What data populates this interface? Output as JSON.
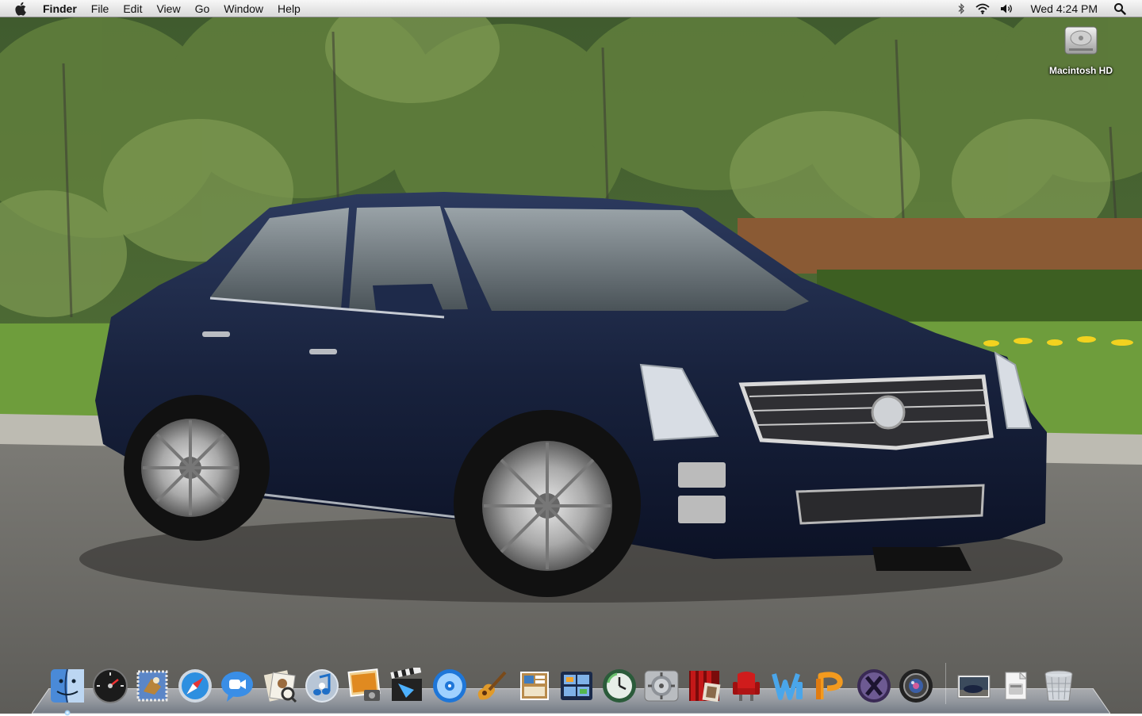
{
  "menubar": {
    "apple_icon": "apple-icon",
    "app_name": "Finder",
    "menus": [
      "File",
      "Edit",
      "View",
      "Go",
      "Window",
      "Help"
    ],
    "status_icons": [
      "bluetooth-icon",
      "wifi-icon",
      "volume-icon"
    ],
    "clock": "Wed 4:24 PM",
    "spotlight_icon": "spotlight-search-icon"
  },
  "desktop": {
    "icons": [
      {
        "label": "Macintosh HD",
        "icon": "hard-drive-icon"
      }
    ]
  },
  "dock": {
    "apps": [
      {
        "icon": "finder-icon",
        "running": true
      },
      {
        "icon": "dashboard-icon",
        "running": false
      },
      {
        "icon": "mail-icon",
        "running": false
      },
      {
        "icon": "safari-icon",
        "running": false
      },
      {
        "icon": "ichat-icon",
        "running": false
      },
      {
        "icon": "address-book-icon",
        "running": false
      },
      {
        "icon": "itunes-icon",
        "running": false
      },
      {
        "icon": "iphoto-icon",
        "running": false
      },
      {
        "icon": "imovie-icon",
        "running": false
      },
      {
        "icon": "idvd-icon",
        "running": false
      },
      {
        "icon": "garageband-icon",
        "running": false
      },
      {
        "icon": "iweb-icon",
        "running": false
      },
      {
        "icon": "spaces-icon",
        "running": false
      },
      {
        "icon": "time-machine-icon",
        "running": false
      },
      {
        "icon": "system-preferences-icon",
        "running": false
      },
      {
        "icon": "front-row-icon",
        "running": false
      },
      {
        "icon": "front-row-chair-icon",
        "running": false
      },
      {
        "icon": "word-icon",
        "running": false
      },
      {
        "icon": "powerpoint-icon",
        "running": false
      },
      {
        "icon": "x11-icon",
        "running": false
      },
      {
        "icon": "aperture-icon",
        "running": false
      }
    ],
    "stacks": [
      {
        "icon": "wallpaper-stack-icon"
      },
      {
        "icon": "documents-stack-icon"
      },
      {
        "icon": "trash-icon"
      }
    ]
  },
  "colors": {
    "car_body": "#1a2440",
    "lawn": "#6a9a3a",
    "road": "#6e6c66",
    "menubar": "#e6e6e6"
  }
}
